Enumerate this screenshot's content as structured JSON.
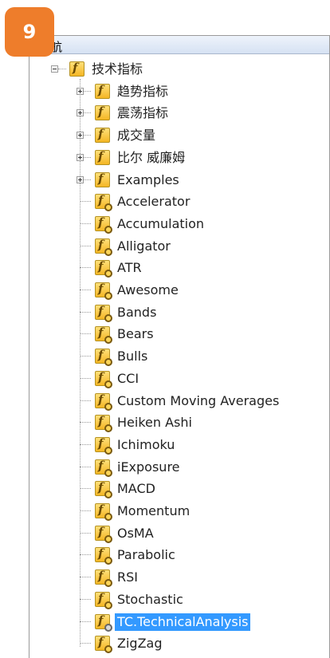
{
  "badge": "9",
  "window": {
    "title": "航"
  },
  "tree": {
    "root": {
      "label": "技术指标",
      "expanded": true
    },
    "folders": [
      {
        "label": "趋势指标",
        "expanded": false
      },
      {
        "label": "震荡指标",
        "expanded": false
      },
      {
        "label": "成交量",
        "expanded": false
      },
      {
        "label": "比尔 威廉姆",
        "expanded": false
      },
      {
        "label": "Examples",
        "expanded": false
      }
    ],
    "indicators": [
      {
        "label": "Accelerator"
      },
      {
        "label": "Accumulation"
      },
      {
        "label": "Alligator"
      },
      {
        "label": "ATR"
      },
      {
        "label": "Awesome"
      },
      {
        "label": "Bands"
      },
      {
        "label": "Bears"
      },
      {
        "label": "Bulls"
      },
      {
        "label": "CCI"
      },
      {
        "label": "Custom Moving Averages"
      },
      {
        "label": "Heiken Ashi"
      },
      {
        "label": "Ichimoku"
      },
      {
        "label": "iExposure"
      },
      {
        "label": "MACD"
      },
      {
        "label": "Momentum"
      },
      {
        "label": "OsMA"
      },
      {
        "label": "Parabolic"
      },
      {
        "label": "RSI"
      },
      {
        "label": "Stochastic"
      },
      {
        "label": "TC.TechnicalAnalysis",
        "selected": true,
        "icon_state": "disabled"
      },
      {
        "label": "ZigZag"
      }
    ]
  },
  "colors": {
    "selection": "#3399ff",
    "badge": "#ee7d2b"
  }
}
